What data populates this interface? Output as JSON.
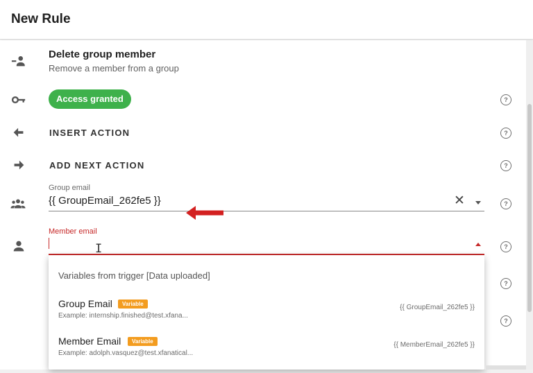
{
  "header": {
    "title": "New Rule"
  },
  "action": {
    "title": "Delete group member",
    "subtitle": "Remove a member from a group"
  },
  "status_chip": {
    "label": "Access granted",
    "color": "#3eb14b"
  },
  "insert_action": {
    "label": "INSERT ACTION"
  },
  "add_next_action": {
    "label": "ADD NEXT ACTION"
  },
  "group_email": {
    "label": "Group email",
    "value": "{{ GroupEmail_262fe5 }}",
    "clear_symbol": "✕"
  },
  "member_email": {
    "label": "Member email",
    "value": ""
  },
  "help_symbol": "?",
  "dropdown": {
    "header": "Variables from trigger [Data uploaded]",
    "items": [
      {
        "name": "Group Email",
        "badge": "Variable",
        "example": "Example: internship.finished@test.xfana...",
        "variable": "{{ GroupEmail_262fe5 }}"
      },
      {
        "name": "Member Email",
        "badge": "Variable",
        "example": "Example: adolph.vasquez@test.xfanatical...",
        "variable": "{{ MemberEmail_262fe5 }}"
      }
    ]
  },
  "colors": {
    "accent_red": "#c62828",
    "annotation_arrow": "#d32020",
    "badge_orange": "#f39c1f"
  },
  "icons": {
    "remove_member": "person-remove-icon",
    "key": "key-icon",
    "insert": "arrow-left-icon",
    "next": "arrow-right-icon",
    "group": "group-icon",
    "person": "person-icon"
  }
}
